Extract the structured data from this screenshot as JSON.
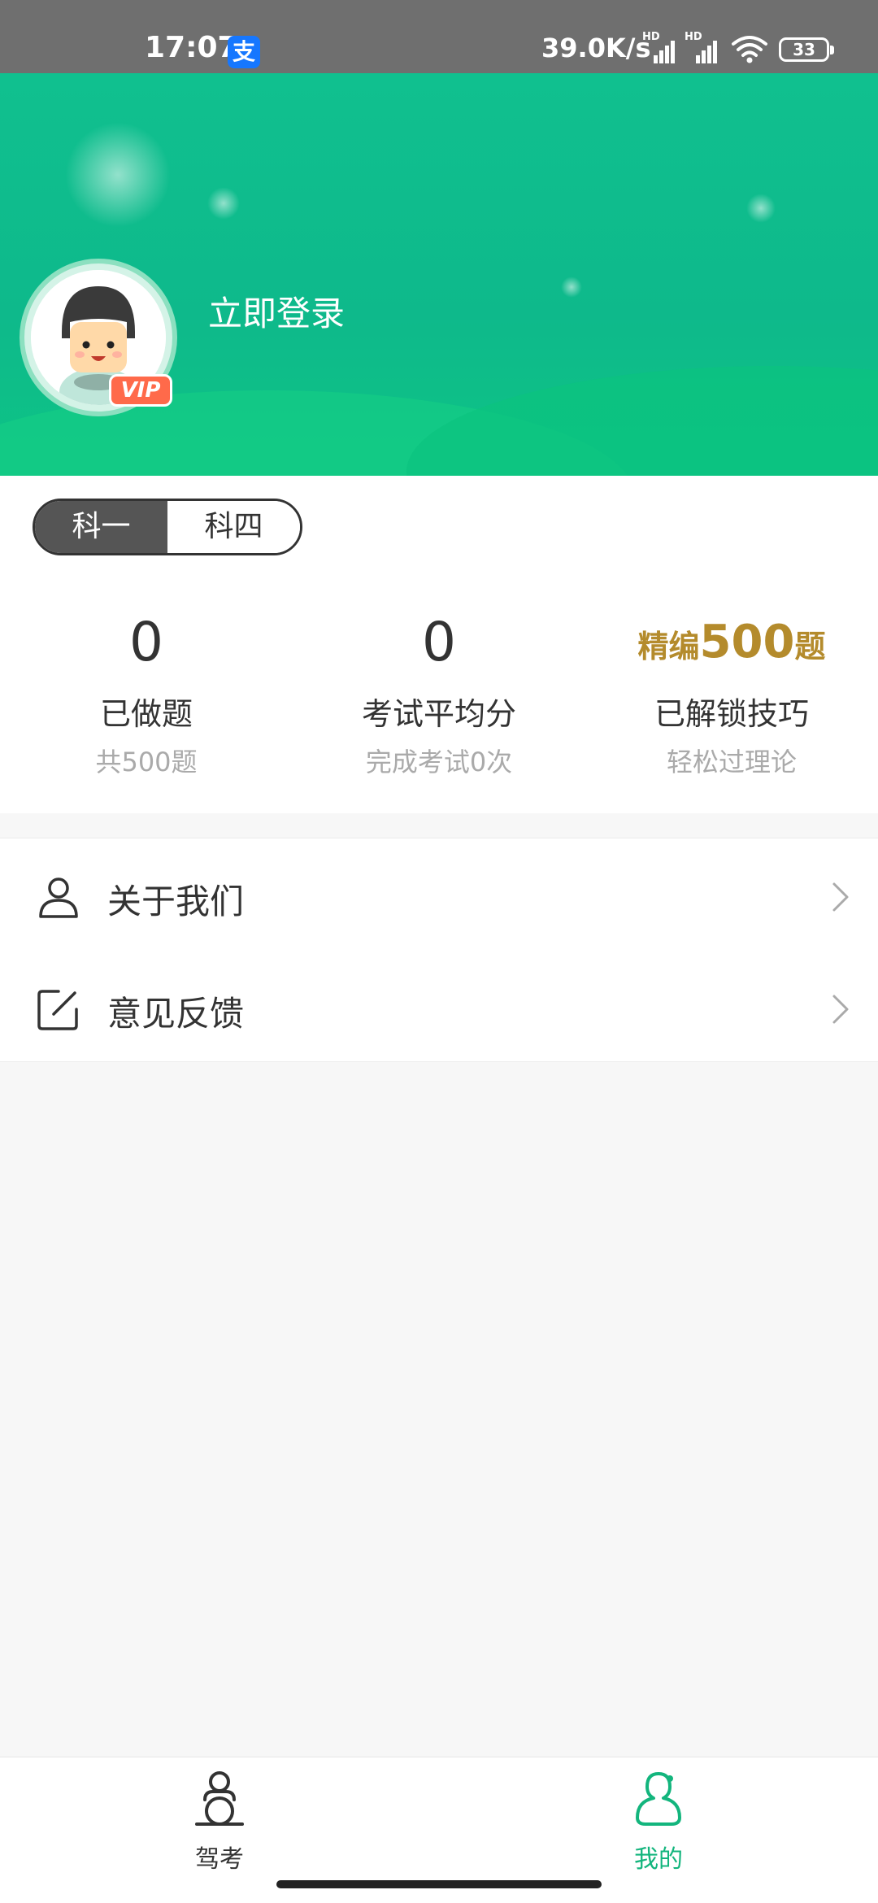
{
  "status_bar": {
    "time": "17:07",
    "alipay_icon_char": "支",
    "net_speed": "39.0K/s",
    "battery": "33"
  },
  "header": {
    "login_text": "立即登录",
    "vip_badge": "VIP"
  },
  "subject_tabs": [
    {
      "label": "科一",
      "active": true
    },
    {
      "label": "科四",
      "active": false
    }
  ],
  "stats": {
    "done": {
      "value": "0",
      "label": "已做题",
      "sub": "共500题"
    },
    "avg_score": {
      "value": "0",
      "label": "考试平均分",
      "sub": "完成考试0次"
    },
    "tips": {
      "prefix": "精编",
      "value": "500",
      "suffix": "题",
      "label": "已解锁技巧",
      "sub": "轻松过理论"
    }
  },
  "menu": [
    {
      "label": "关于我们",
      "icon": "user-icon"
    },
    {
      "label": "意见反馈",
      "icon": "edit-icon"
    }
  ],
  "tabbar": [
    {
      "label": "驾考",
      "icon": "driver-icon",
      "active": false
    },
    {
      "label": "我的",
      "icon": "profile-icon",
      "active": true
    }
  ],
  "colors": {
    "brand_green": "#10c08f",
    "active_tab": "#13b57d",
    "gold": "#b48b2c",
    "vip_orange": "#ff6a4a"
  }
}
